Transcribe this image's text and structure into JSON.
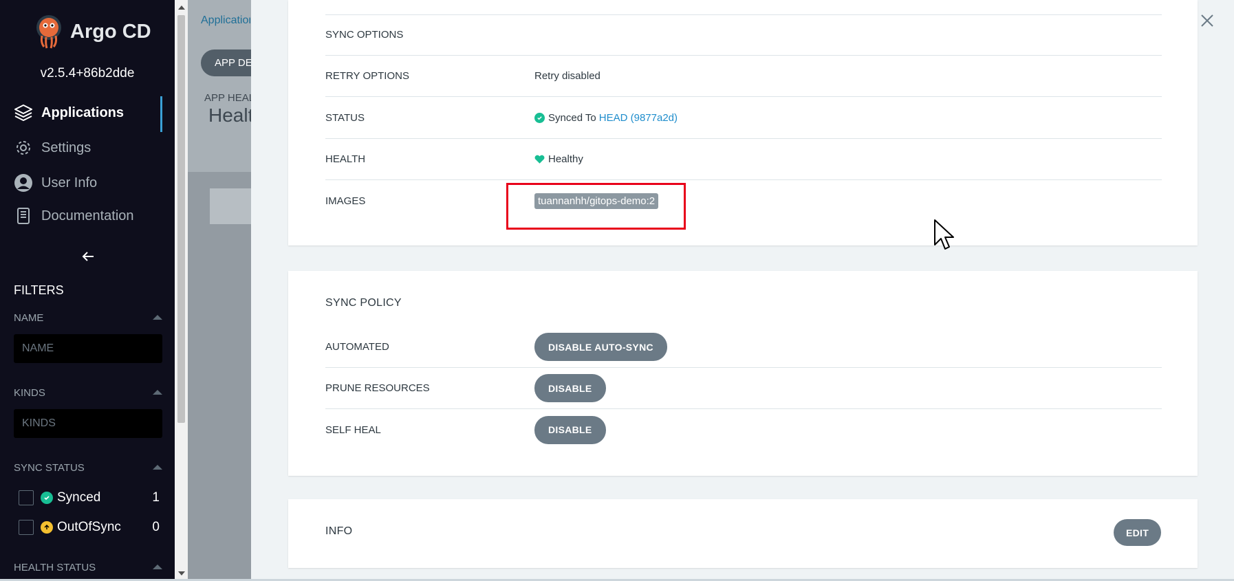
{
  "sidebar": {
    "brand": "Argo CD",
    "version": "v2.5.4+86b2dde",
    "nav": [
      {
        "label": "Applications",
        "icon": "layers-icon",
        "active": true
      },
      {
        "label": "Settings",
        "icon": "gear-icon",
        "active": false
      },
      {
        "label": "User Info",
        "icon": "user-icon",
        "active": false
      },
      {
        "label": "Documentation",
        "icon": "book-icon",
        "active": false
      }
    ],
    "filters_title": "FILTERS",
    "name_label": "NAME",
    "name_placeholder": "NAME",
    "kinds_label": "KINDS",
    "kinds_placeholder": "KINDS",
    "sync_status_label": "SYNC STATUS",
    "sync_items": [
      {
        "label": "Synced",
        "count": "1"
      },
      {
        "label": "OutOfSync",
        "count": "0"
      }
    ],
    "health_status_label": "HEALTH STATUS"
  },
  "background": {
    "breadcrumb": "Applications",
    "app_pill": "APP DETAILS",
    "app_health_label": "APP HEALTH",
    "app_health_value": "Healthy"
  },
  "details": {
    "rows": [
      {
        "label": "SYNC OPTIONS",
        "value": ""
      },
      {
        "label": "RETRY OPTIONS",
        "value": "Retry disabled"
      },
      {
        "label": "STATUS",
        "value": "Synced To",
        "link": "HEAD (9877a2d)"
      },
      {
        "label": "HEALTH",
        "value": "Healthy"
      },
      {
        "label": "IMAGES",
        "value": "tuannanhh/gitops-demo:2"
      }
    ]
  },
  "sync_policy": {
    "title": "SYNC POLICY",
    "rows": [
      {
        "label": "AUTOMATED",
        "button": "DISABLE AUTO-SYNC"
      },
      {
        "label": "PRUNE RESOURCES",
        "button": "DISABLE"
      },
      {
        "label": "SELF HEAL",
        "button": "DISABLE"
      }
    ]
  },
  "info": {
    "title": "INFO",
    "edit_label": "EDIT"
  },
  "colors": {
    "sidebar_bg": "#0e0e1c",
    "accent": "#1f8dcc",
    "healthy": "#18be94",
    "outofsync": "#f4c030",
    "highlight": "#e8001a",
    "button_bg": "#6b7a86"
  }
}
